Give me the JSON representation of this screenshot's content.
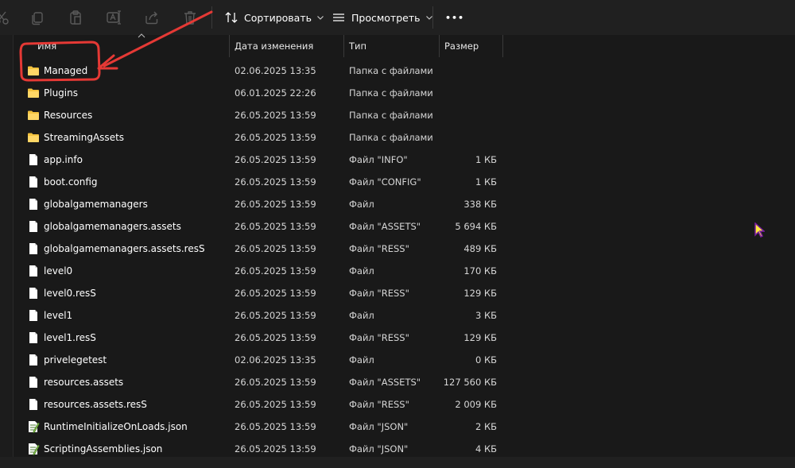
{
  "toolbar": {
    "icons": [
      "cut-icon",
      "copy-icon",
      "paste-icon",
      "rename-icon",
      "share-icon",
      "delete-icon"
    ],
    "sort_label": "Сортировать",
    "view_label": "Просмотреть",
    "more_label": "•••"
  },
  "columns": {
    "name": "Имя",
    "date": "Дата изменения",
    "type": "Тип",
    "size": "Размер"
  },
  "files": [
    {
      "name": "Managed",
      "date": "02.06.2025 13:35",
      "type": "Папка с файлами",
      "size": "",
      "icon": "folder-icon"
    },
    {
      "name": "Plugins",
      "date": "06.01.2025 22:26",
      "type": "Папка с файлами",
      "size": "",
      "icon": "folder-icon"
    },
    {
      "name": "Resources",
      "date": "26.05.2025 13:59",
      "type": "Папка с файлами",
      "size": "",
      "icon": "folder-icon"
    },
    {
      "name": "StreamingAssets",
      "date": "26.05.2025 13:59",
      "type": "Папка с файлами",
      "size": "",
      "icon": "folder-icon"
    },
    {
      "name": "app.info",
      "date": "26.05.2025 13:59",
      "type": "Файл \"INFO\"",
      "size": "1 КБ",
      "icon": "file-icon"
    },
    {
      "name": "boot.config",
      "date": "26.05.2025 13:59",
      "type": "Файл \"CONFIG\"",
      "size": "1 КБ",
      "icon": "file-icon"
    },
    {
      "name": "globalgamemanagers",
      "date": "26.05.2025 13:59",
      "type": "Файл",
      "size": "338 КБ",
      "icon": "file-icon"
    },
    {
      "name": "globalgamemanagers.assets",
      "date": "26.05.2025 13:59",
      "type": "Файл \"ASSETS\"",
      "size": "5 694 КБ",
      "icon": "file-icon"
    },
    {
      "name": "globalgamemanagers.assets.resS",
      "date": "26.05.2025 13:59",
      "type": "Файл \"RESS\"",
      "size": "489 КБ",
      "icon": "file-icon"
    },
    {
      "name": "level0",
      "date": "26.05.2025 13:59",
      "type": "Файл",
      "size": "170 КБ",
      "icon": "file-icon"
    },
    {
      "name": "level0.resS",
      "date": "26.05.2025 13:59",
      "type": "Файл \"RESS\"",
      "size": "129 КБ",
      "icon": "file-icon"
    },
    {
      "name": "level1",
      "date": "26.05.2025 13:59",
      "type": "Файл",
      "size": "3 КБ",
      "icon": "file-icon"
    },
    {
      "name": "level1.resS",
      "date": "26.05.2025 13:59",
      "type": "Файл \"RESS\"",
      "size": "129 КБ",
      "icon": "file-icon"
    },
    {
      "name": "privelegetest",
      "date": "02.06.2025 13:35",
      "type": "Файл",
      "size": "0 КБ",
      "icon": "file-icon"
    },
    {
      "name": "resources.assets",
      "date": "26.05.2025 13:59",
      "type": "Файл \"ASSETS\"",
      "size": "127 560 КБ",
      "icon": "file-icon"
    },
    {
      "name": "resources.assets.resS",
      "date": "26.05.2025 13:59",
      "type": "Файл \"RESS\"",
      "size": "2 009 КБ",
      "icon": "file-icon"
    },
    {
      "name": "RuntimeInitializeOnLoads.json",
      "date": "26.05.2025 13:59",
      "type": "Файл \"JSON\"",
      "size": "2 КБ",
      "icon": "json-file-icon"
    },
    {
      "name": "ScriptingAssemblies.json",
      "date": "26.05.2025 13:59",
      "type": "Файл \"JSON\"",
      "size": "4 КБ",
      "icon": "json-file-icon"
    }
  ],
  "colors": {
    "folder": "#f4c33f",
    "annotation": "#e53935",
    "background": "#191919"
  }
}
